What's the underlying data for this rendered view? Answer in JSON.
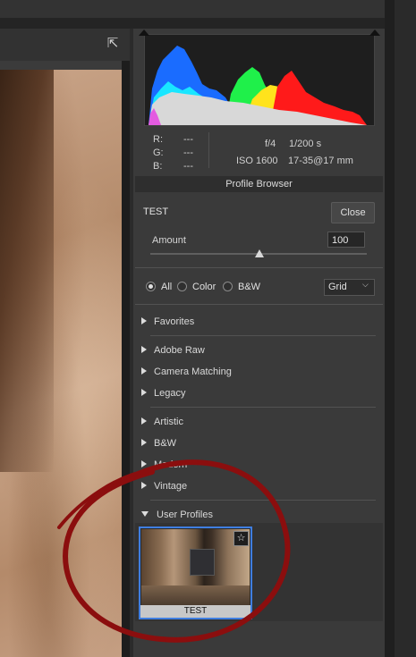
{
  "meta": {
    "r_label": "R:",
    "g_label": "G:",
    "b_label": "B:",
    "r_value": "---",
    "g_value": "---",
    "b_value": "---",
    "aperture": "f/4",
    "shutter": "1/200 s",
    "iso": "ISO 1600",
    "lens": "17-35@17 mm"
  },
  "profile_browser": {
    "title": "Profile Browser",
    "current_profile": "TEST",
    "close_label": "Close",
    "amount_label": "Amount",
    "amount_value": "100",
    "amount_fraction": 0.5
  },
  "filter": {
    "options": [
      "All",
      "Color",
      "B&W"
    ],
    "selected": "All",
    "view_mode": "Grid"
  },
  "groups": {
    "favorites": "Favorites",
    "adobe_raw": "Adobe Raw",
    "camera_matching": "Camera Matching",
    "legacy": "Legacy",
    "artistic": "Artistic",
    "bw": "B&W",
    "modern": "Modern",
    "vintage": "Vintage",
    "user_profiles": "User Profiles"
  },
  "user_profiles": [
    {
      "label": "TEST",
      "favorite_icon": "star-outline-icon"
    }
  ],
  "colors": {
    "selection_border": "#3f7ee0",
    "annotation_red": "#8b0e0e"
  }
}
